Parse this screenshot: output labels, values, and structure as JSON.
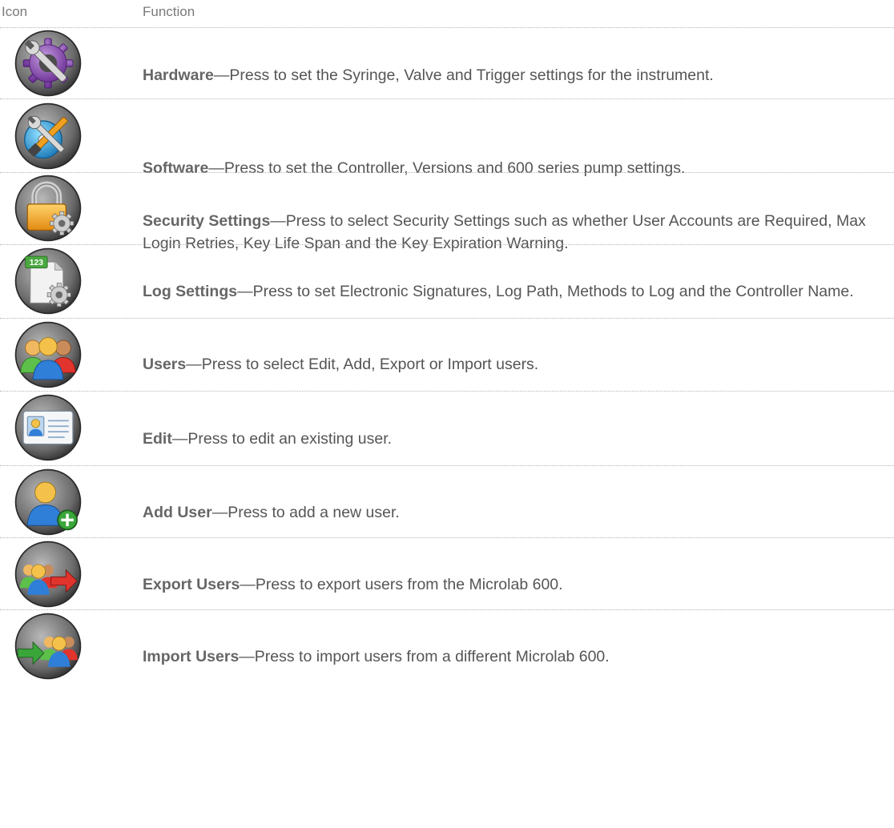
{
  "header": {
    "icon_label": "Icon",
    "function_label": "Function"
  },
  "dash": "—",
  "rows": [
    {
      "icon": "gear-wrench-icon",
      "term": "Hardware",
      "desc": "Press to set the Syringe, Valve and Trigger settings for the instrument."
    },
    {
      "icon": "disc-wrench-icon",
      "term": "Software",
      "desc": "Press to set the Controller, Versions and 600 series pump settings."
    },
    {
      "icon": "padlock-gear-icon",
      "term": "Security Settings",
      "desc": "Press to select Security Settings such as whether User Accounts are Required, Max Login Retries, Key Life Span and the Key Expiration Warning."
    },
    {
      "icon": "log-document-gear-icon",
      "term": "Log Settings",
      "desc": "Press to set Electronic Signatures, Log Path, Methods to Log and the Controller Name."
    },
    {
      "icon": "users-group-icon",
      "term": "Users",
      "desc": "Press to select Edit, Add, Export or Import users."
    },
    {
      "icon": "id-card-icon",
      "term": "Edit",
      "desc": "Press to edit an existing user."
    },
    {
      "icon": "add-user-icon",
      "term": "Add User",
      "desc": "Press to add a new user."
    },
    {
      "icon": "export-users-icon",
      "term": "Export Users",
      "desc": "Press to export users from the Microlab 600."
    },
    {
      "icon": "import-users-icon",
      "term": "Import Users",
      "desc": "Press to import users from a different Microlab 600."
    }
  ],
  "icon_text": {
    "log_number": "123"
  }
}
